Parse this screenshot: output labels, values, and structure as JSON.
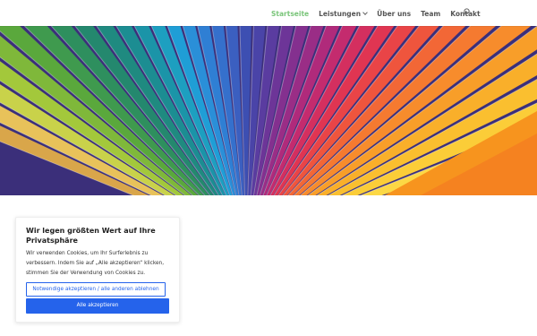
{
  "nav": {
    "items": [
      {
        "label": "Startseite",
        "active": true
      },
      {
        "label": "Leistungen",
        "has_dropdown": true
      },
      {
        "label": "Über uns"
      },
      {
        "label": "Team"
      },
      {
        "label": "Kontakt"
      }
    ],
    "search_icon": "search-icon",
    "active_color": "#7ac57a"
  },
  "hero": {
    "image": "rainbow-color-swatch-fan"
  },
  "cookie": {
    "title": "Wir legen größten Wert auf Ihre Privatsphäre",
    "body": "Wir verwenden Cookies, um Ihr Surferlebnis zu verbessern. Indem Sie auf „Alle akzeptieren“ klicken, stimmen Sie der Verwendung von Cookies zu.",
    "reject_label": "Notwendige akzeptieren / alle anderen ablehnen",
    "accept_label": "Alle akzeptieren",
    "accent_color": "#2563eb"
  }
}
